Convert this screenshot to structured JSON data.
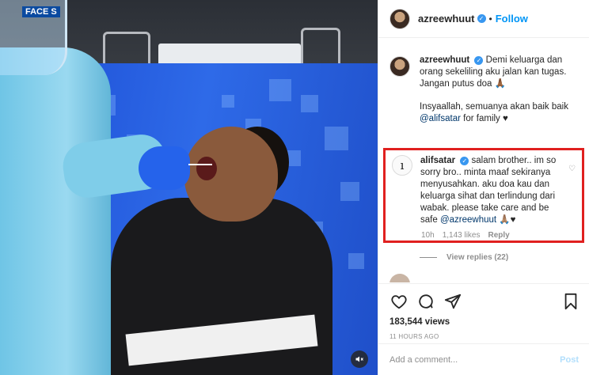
{
  "media": {
    "shield_text": "FACE S",
    "mute_icon": "speaker-muted-icon"
  },
  "header": {
    "username": "azreewhuut",
    "separator": "•",
    "follow_label": "Follow"
  },
  "caption": {
    "username": "azreewhuut",
    "text_line1": "Demi keluarga dan orang sekeliling aku jalan kan tugas. Jangan putus doa",
    "emoji": "🙏🏾",
    "text_line2": "Insyaallah, semuanya akan baik baik",
    "mention": "@alifsatar",
    "text_line2_end": "for family ♥"
  },
  "highlighted_comment": {
    "username": "alifsatar",
    "avatar_letter": "ı",
    "text": "salam brother.. im so sorry bro.. minta maaf sekiranya menyusahkan. aku doa kau dan keluarga sihat dan terlindung dari wabak. please take care and be safe",
    "mention": "@azreewhuut",
    "suffix": "🙏🏽♥",
    "age": "10h",
    "likes": "1,143 likes",
    "reply_label": "Reply",
    "border_color": "#e0201f"
  },
  "view_replies_label": "View replies (22)",
  "actions": {
    "views": "183,544 views",
    "timestamp": "11 HOURS AGO"
  },
  "add_comment": {
    "placeholder": "Add a comment...",
    "post_label": "Post"
  }
}
